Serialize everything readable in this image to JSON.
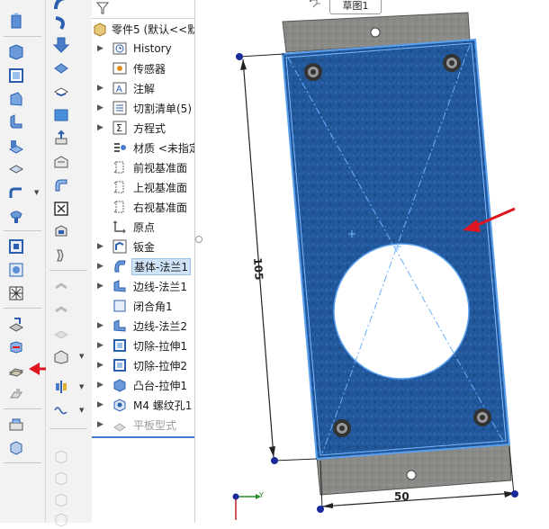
{
  "tree": {
    "items": [
      {
        "label": "零件5 (默认<<默",
        "icon": "part-icon",
        "arrow": ""
      },
      {
        "label": "History",
        "icon": "history-icon",
        "arrow": "▶"
      },
      {
        "label": "传感器",
        "icon": "sensor-icon",
        "arrow": ""
      },
      {
        "label": "注解",
        "icon": "annotation-icon",
        "arrow": "▶"
      },
      {
        "label": "切割清单(5)",
        "icon": "cut-list-icon",
        "arrow": "▶"
      },
      {
        "label": "方程式",
        "icon": "equation-icon",
        "arrow": "▶"
      },
      {
        "label": "材质 <未指定>",
        "icon": "material-icon",
        "arrow": ""
      },
      {
        "label": "前视基准面",
        "icon": "plane-icon",
        "arrow": ""
      },
      {
        "label": "上视基准面",
        "icon": "plane-icon",
        "arrow": ""
      },
      {
        "label": "右视基准面",
        "icon": "plane-icon",
        "arrow": ""
      },
      {
        "label": "原点",
        "icon": "origin-icon",
        "arrow": ""
      },
      {
        "label": "钣金",
        "icon": "sheet-metal-icon",
        "arrow": "▶"
      },
      {
        "label": "基体-法兰1",
        "icon": "base-flange-icon",
        "arrow": "▶"
      },
      {
        "label": "边线-法兰1",
        "icon": "edge-flange-icon",
        "arrow": "▶"
      },
      {
        "label": "闭合角1",
        "icon": "closed-corner-icon",
        "arrow": ""
      },
      {
        "label": "边线-法兰2",
        "icon": "edge-flange-icon",
        "arrow": "▶"
      },
      {
        "label": "切除-拉伸1",
        "icon": "cut-extrude-icon",
        "arrow": "▶"
      },
      {
        "label": "切除-拉伸2",
        "icon": "cut-extrude-icon",
        "arrow": "▶"
      },
      {
        "label": "凸台-拉伸1",
        "icon": "boss-extrude-icon",
        "arrow": "▶"
      },
      {
        "label": "M4 螺纹孔1",
        "icon": "hole-wizard-icon",
        "arrow": "▶"
      },
      {
        "label": "平板型式",
        "icon": "flat-pattern-icon",
        "arrow": "▶"
      }
    ]
  },
  "viewport": {
    "sketch_tab": "草图1",
    "dim_height": "105",
    "dim_width": "50",
    "axis_y": "Y",
    "axis_x": "X"
  },
  "colors": {
    "accent_blue": "#2a5fb0",
    "selection_blue": "#4a8ee0",
    "arrow_red": "#e0151f",
    "plate_gray": "#8a8a86"
  }
}
